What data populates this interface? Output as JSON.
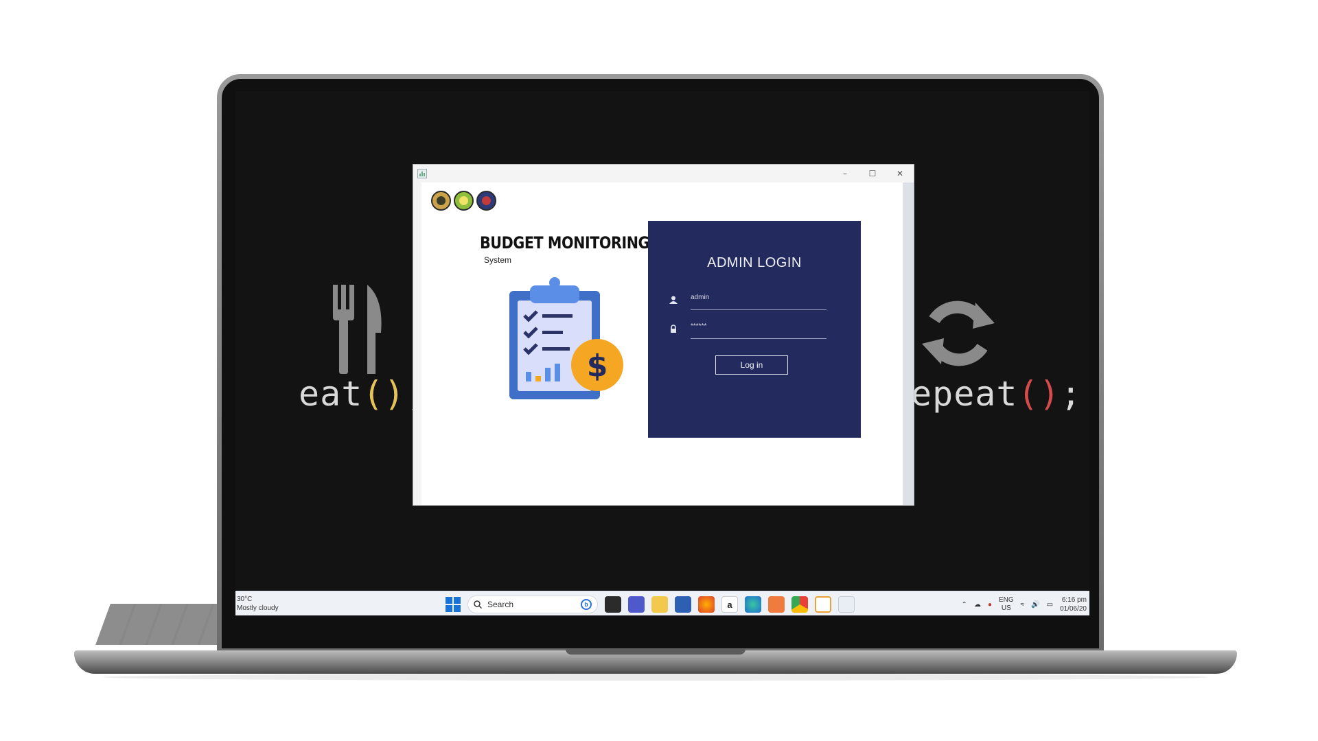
{
  "wallpaper": {
    "left_code_prefix": "eat",
    "left_code_parens": "()",
    "left_code_suffix": ";",
    "right_code_prefix": "epeat",
    "right_code_parens": "()",
    "right_code_suffix": ";",
    "left_icon": "utensils-icon",
    "right_icon": "refresh-icon"
  },
  "window": {
    "app_icon": "java-app-icon",
    "minimize": "–",
    "maximize": "☐",
    "close": "✕"
  },
  "app": {
    "logos": [
      "seal-1-icon",
      "seal-2-icon",
      "seal-3-icon"
    ],
    "title": "BUDGET MONITORING",
    "subtitle": "System",
    "illustration": "clipboard-budget-icon",
    "login": {
      "heading": "ADMIN LOGIN",
      "username_value": "admin",
      "password_value": "******",
      "button": "Log in"
    }
  },
  "taskbar": {
    "weather_temp": "30°C",
    "weather_desc": "Mostly cloudy",
    "search_label": "Search",
    "lang_line1": "ENG",
    "lang_line2": "US",
    "time": "6:16 pm",
    "date": "01/06/20"
  },
  "colors": {
    "login_panel": "#232a5e",
    "illustration_blue": "#3f6fc6",
    "coin_orange": "#f5a623",
    "accent_yellow": "#e6c25b",
    "accent_red": "#d54b4b"
  }
}
